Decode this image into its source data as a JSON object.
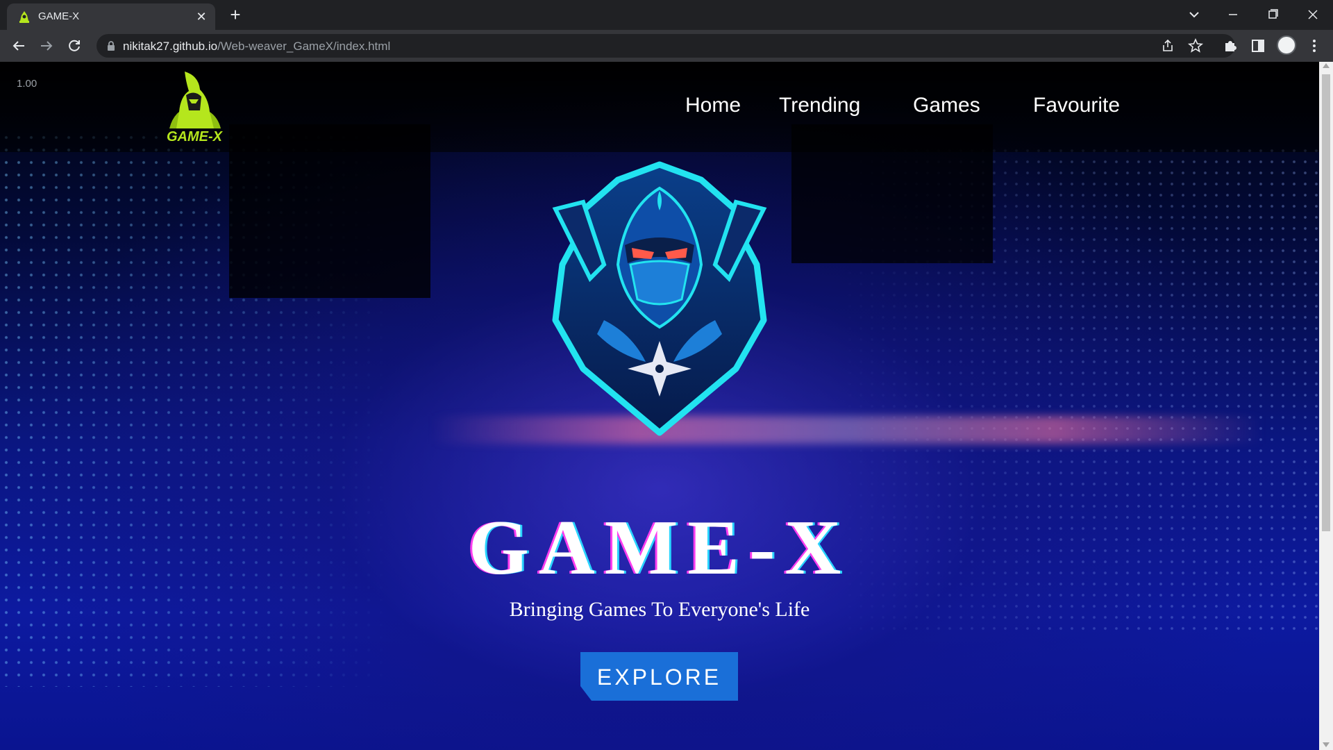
{
  "browser": {
    "tab_title": "GAME-X",
    "tab_close": "✕",
    "new_tab": "+",
    "url_host": "nikitak27.github.io",
    "url_path": "/Web-weaver_GameX/index.html",
    "icons": [
      "back-icon",
      "forward-icon",
      "reload-icon",
      "lock-icon",
      "share-icon",
      "star-icon",
      "extensions-icon",
      "side-panel-icon",
      "profile-avatar",
      "menu-icon",
      "tab-search-icon",
      "minimize-icon",
      "restore-icon",
      "close-window-icon"
    ]
  },
  "page": {
    "zoom_label": "1.00",
    "nav": {
      "home": "Home",
      "trending": "Trending",
      "games": "Games",
      "favourite": "Favourite"
    },
    "brand_title": "GAME-X",
    "tagline": "Bringing Games To Everyone's Life",
    "explore_label": "EXPLORE",
    "logo_text": "GAME-X"
  },
  "colors": {
    "accent_blue": "#1a6fd8",
    "logo_green": "#b5e61d",
    "emblem_cyan": "#22e3f0"
  }
}
